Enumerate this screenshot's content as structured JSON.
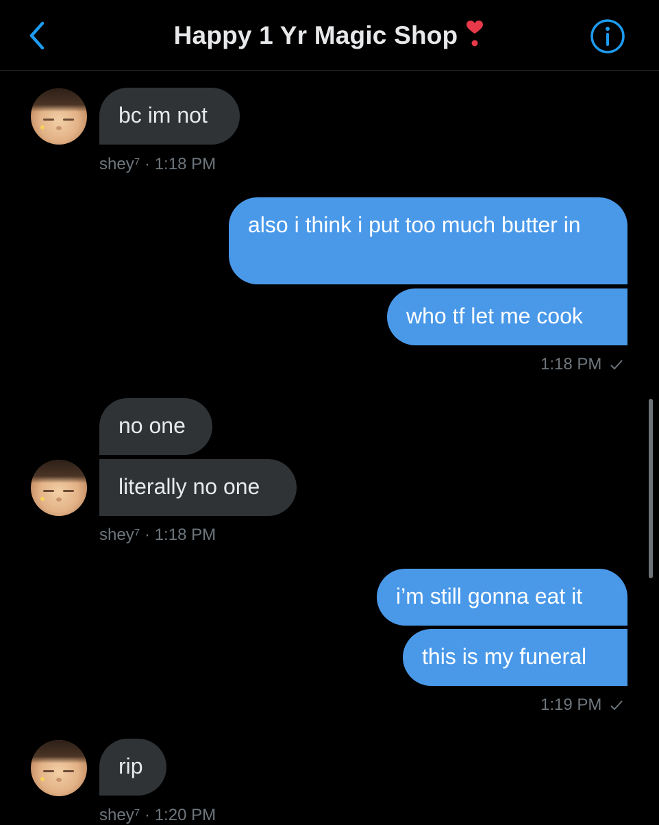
{
  "header": {
    "title": "Happy 1 Yr Magic Shop",
    "back_icon": "chevron-left-icon",
    "info_icon": "info-circle-icon",
    "emoji": "heavy-heart-exclamation",
    "accent_color": "#1d9bf0"
  },
  "messages": [
    {
      "side": "in",
      "text": "bc im not"
    },
    {
      "meta": "shey⁷ · 1:18 PM"
    },
    {
      "side": "out",
      "text": "also i think i put too much butter in"
    },
    {
      "side": "out",
      "text": "who tf let me cook"
    },
    {
      "meta": "1:18 PM"
    },
    {
      "side": "in",
      "text": "no one"
    },
    {
      "side": "in",
      "text": "literally no one"
    },
    {
      "meta": "shey⁷ · 1:18 PM"
    },
    {
      "side": "out",
      "text": "i’m still gonna eat it"
    },
    {
      "side": "out",
      "text": "this is my funeral"
    },
    {
      "meta": "1:19 PM"
    },
    {
      "side": "in",
      "text": "rip"
    },
    {
      "meta": "shey⁷ · 1:20 PM"
    }
  ],
  "colors": {
    "incoming_bubble": "#2f3336",
    "outgoing_bubble": "#4a99e9",
    "meta_text": "#6e767d"
  }
}
